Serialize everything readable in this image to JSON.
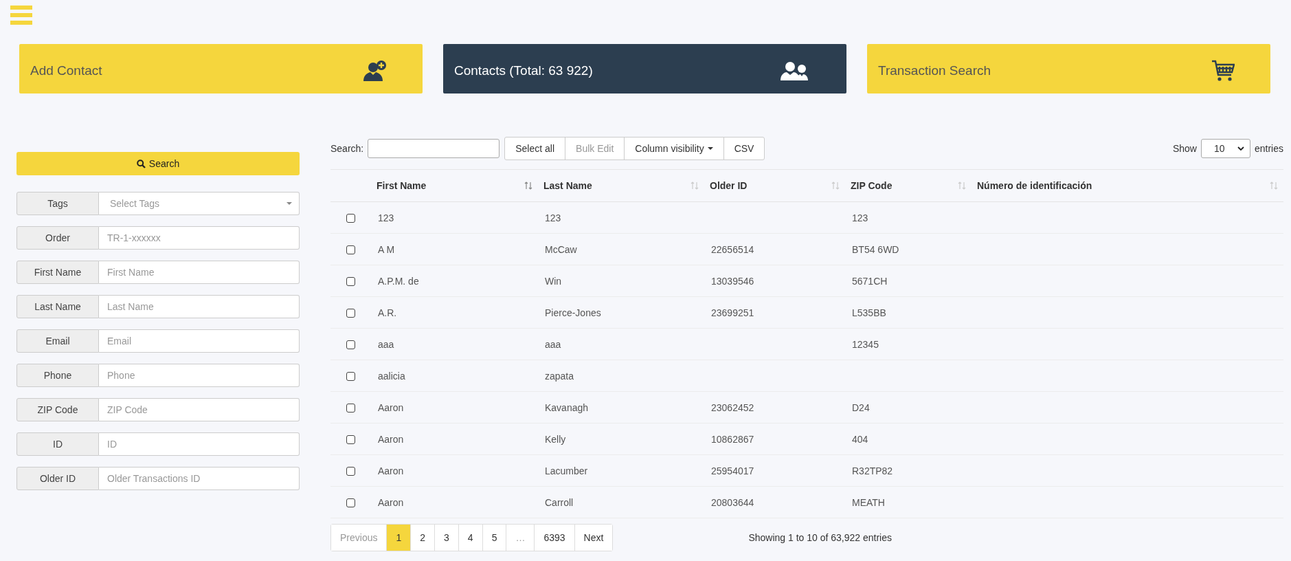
{
  "nav_cards": [
    {
      "kind": "add-contact",
      "label": "Add Contact",
      "selected": false
    },
    {
      "kind": "contacts",
      "label": "Contacts (Total: 63 922)",
      "selected": true
    },
    {
      "kind": "cart",
      "label": "Transaction Search",
      "selected": false
    }
  ],
  "filters": {
    "search_button": "Search",
    "fields": [
      {
        "kind": "select",
        "label": "Tags",
        "placeholder": "Select Tags"
      },
      {
        "kind": "text",
        "label": "Order",
        "placeholder": "TR-1-xxxxxx"
      },
      {
        "kind": "text",
        "label": "First Name",
        "placeholder": "First Name"
      },
      {
        "kind": "text",
        "label": "Last Name",
        "placeholder": "Last Name"
      },
      {
        "kind": "text",
        "label": "Email",
        "placeholder": "Email"
      },
      {
        "kind": "text",
        "label": "Phone",
        "placeholder": "Phone"
      },
      {
        "kind": "text",
        "label": "ZIP Code",
        "placeholder": "ZIP Code"
      },
      {
        "kind": "text",
        "label": "ID",
        "placeholder": "ID"
      },
      {
        "kind": "text",
        "label": "Older ID",
        "placeholder": "Older Transactions ID"
      }
    ]
  },
  "toolbar": {
    "search_label": "Search:",
    "buttons": [
      {
        "label": "Select all",
        "disabled": false,
        "dropdown": false
      },
      {
        "label": "Bulk Edit",
        "disabled": true,
        "dropdown": false
      },
      {
        "label": "Column visibility",
        "disabled": false,
        "dropdown": true
      },
      {
        "label": "CSV",
        "disabled": false,
        "dropdown": false
      }
    ],
    "show_label": "Show",
    "page_size": "10",
    "entries_label": "entries"
  },
  "table": {
    "columns": [
      {
        "label": "First Name",
        "sorted": true
      },
      {
        "label": "Last Name",
        "sorted": false
      },
      {
        "label": "Older ID",
        "sorted": false
      },
      {
        "label": "ZIP Code",
        "sorted": false
      },
      {
        "label": "Número de identificación",
        "sorted": false
      }
    ],
    "rows": [
      {
        "checked": false,
        "cells": [
          "123",
          "123",
          "",
          "123",
          ""
        ]
      },
      {
        "checked": false,
        "cells": [
          "A M",
          "McCaw",
          "22656514",
          "BT54 6WD",
          ""
        ]
      },
      {
        "checked": false,
        "cells": [
          "A.P.M. de",
          "Win",
          "13039546",
          "5671CH",
          ""
        ]
      },
      {
        "checked": false,
        "cells": [
          "A.R.",
          "Pierce-Jones",
          "23699251",
          "L535BB",
          ""
        ]
      },
      {
        "checked": false,
        "cells": [
          "aaa",
          "aaa",
          "",
          "12345",
          ""
        ]
      },
      {
        "checked": false,
        "cells": [
          "aalicia",
          "zapata",
          "",
          "",
          ""
        ]
      },
      {
        "checked": false,
        "cells": [
          "Aaron",
          "Kavanagh",
          "23062452",
          "D24",
          ""
        ]
      },
      {
        "checked": false,
        "cells": [
          "Aaron",
          "Kelly",
          "10862867",
          "404",
          ""
        ]
      },
      {
        "checked": false,
        "cells": [
          "Aaron",
          "Lacumber",
          "25954017",
          "R32TP82",
          ""
        ]
      },
      {
        "checked": false,
        "cells": [
          "Aaron",
          "Carroll",
          "20803644",
          "MEATH",
          ""
        ]
      }
    ]
  },
  "pagination": {
    "pages": [
      {
        "label": "Previous",
        "selected": false,
        "disabled": true
      },
      {
        "label": "1",
        "selected": true,
        "disabled": false
      },
      {
        "label": "2",
        "selected": false,
        "disabled": false
      },
      {
        "label": "3",
        "selected": false,
        "disabled": false
      },
      {
        "label": "4",
        "selected": false,
        "disabled": false
      },
      {
        "label": "5",
        "selected": false,
        "disabled": false
      },
      {
        "label": "…",
        "selected": false,
        "disabled": true
      },
      {
        "label": "6393",
        "selected": false,
        "disabled": false
      },
      {
        "label": "Next",
        "selected": false,
        "disabled": false
      }
    ],
    "info": "Showing 1 to 10 of 63,922 entries"
  }
}
